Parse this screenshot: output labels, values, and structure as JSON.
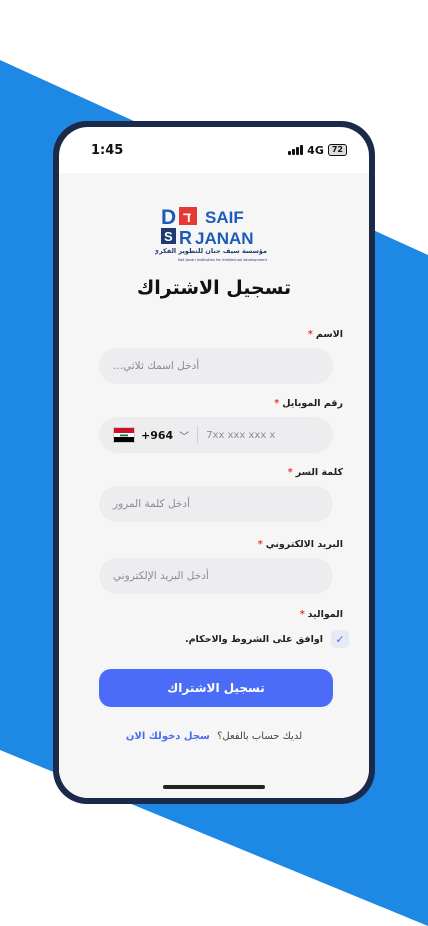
{
  "status": {
    "time": "1:45",
    "network": "4G",
    "battery": "72"
  },
  "logo": {
    "letters": [
      "D",
      "ד",
      "S",
      "R"
    ],
    "line1": "SAIF",
    "line2": "JANAN",
    "arabic": "مؤسسة سيف جنان للتطوير الفكري",
    "english": "Saif Janan Institution for intellectual development"
  },
  "form": {
    "title": "تسجيل الاشتراك",
    "name_label": "الاسم",
    "name_placeholder": "أدخل اسمك ثلاثي...",
    "mobile_label": "رقم الموبايل",
    "country_code": "+964",
    "mobile_placeholder": "7xx xxx xxx x",
    "password_label": "كلمة السر",
    "password_placeholder": "أدخل كلمة المرور",
    "email_label": "البريد الالكتروني",
    "email_placeholder": "أدخل البريد الإلكتروني",
    "birth_label": "المواليد",
    "required_mark": "*",
    "terms_text": "اوافق على الشروط والاحكام.",
    "terms_checked": true,
    "submit_label": "تسجيل الاشتراك",
    "have_account": "لديك حساب بالفعل؟",
    "login_link": "سجل دخولك الان"
  },
  "colors": {
    "accent": "#4a6cf7",
    "background_band": "#1e88e5",
    "frame": "#1c2a4a"
  }
}
